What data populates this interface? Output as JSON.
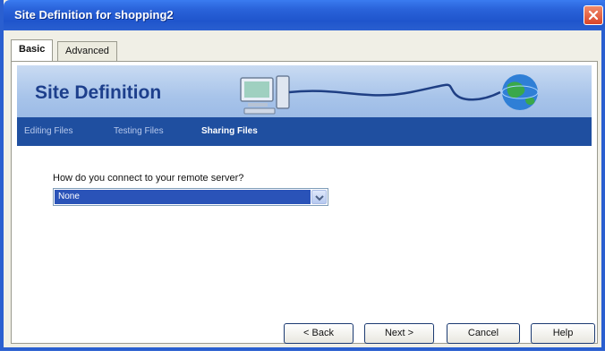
{
  "window": {
    "title": "Site Definition for shopping2"
  },
  "tabs": [
    {
      "label": "Basic",
      "active": true
    },
    {
      "label": "Advanced",
      "active": false
    }
  ],
  "banner": {
    "title": "Site Definition"
  },
  "steps": [
    {
      "label": "Editing Files",
      "current": false
    },
    {
      "label": "Testing Files",
      "current": false
    },
    {
      "label": "Sharing Files",
      "current": true
    }
  ],
  "form": {
    "question": "How do you connect to your remote server?",
    "connection_selected": "None"
  },
  "buttons": {
    "back": "< Back",
    "next": "Next >",
    "cancel": "Cancel",
    "help": "Help"
  },
  "colors": {
    "title_bar": "#2a5fd0",
    "step_bar": "#1f4fa0",
    "selection": "#2a53b8",
    "banner_title": "#1d3f8c"
  },
  "icons": [
    "close-icon",
    "computer-icon",
    "cable-icon",
    "globe-icon",
    "dropdown-arrow-icon"
  ]
}
